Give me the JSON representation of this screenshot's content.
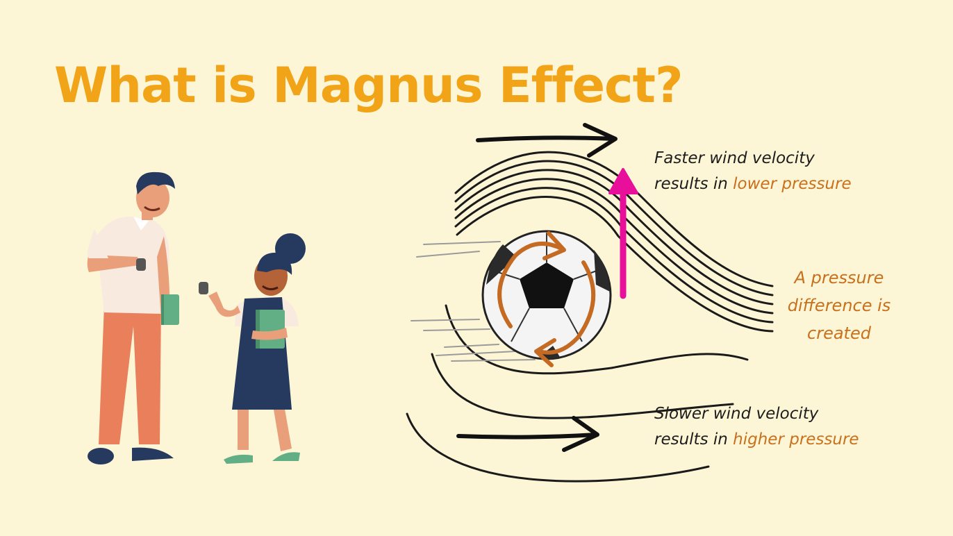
{
  "title": "What is Magnus Effect?",
  "labels": {
    "top": {
      "line1": "Faster wind velocity",
      "line2_prefix": "results in ",
      "line2_accent": "lower pressure"
    },
    "middle": {
      "line1": "A pressure",
      "line2": "difference is",
      "line3": "created"
    },
    "bottom": {
      "line1": "Slower wind velocity",
      "line2_prefix": "results in ",
      "line2_accent": "higher pressure"
    }
  },
  "colors": {
    "background": "#fdf6d6",
    "title": "#f2a418",
    "accent_text": "#c8701c",
    "lift_arrow": "#e8109b",
    "spin_arrows": "#c46a22",
    "flow_lines": "#1a1a1a"
  },
  "icons": [
    "soccer-ball-icon",
    "teacher-figure",
    "student-figure",
    "lift-arrow-icon",
    "flow-arrow-icon",
    "spin-arrow-icon"
  ]
}
